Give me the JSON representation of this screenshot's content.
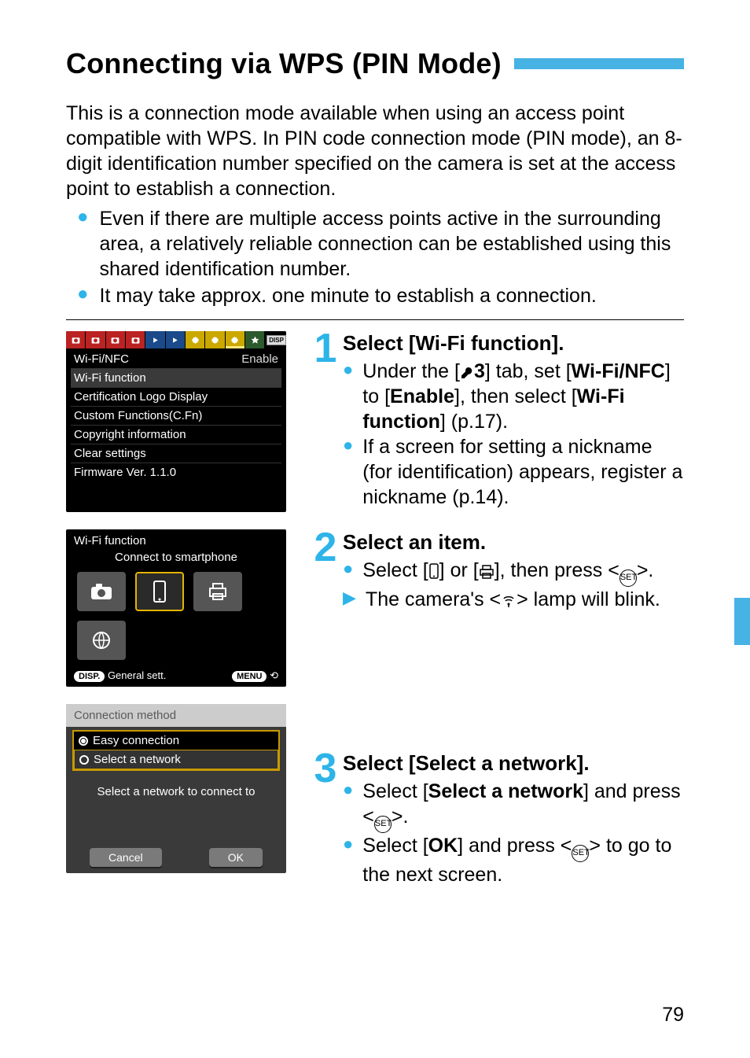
{
  "title": "Connecting via WPS (PIN Mode)",
  "intro": "This is a connection mode available when using an access point compatible with WPS. In PIN code connection mode (PIN mode), an 8-digit identification number specified on the camera is set at the access point to establish a connection.",
  "top_bullets": [
    "Even if there are multiple access points active in the surrounding area, a relatively reliable connection can be established using this shared identification number.",
    "It may take approx. one minute to establish a connection."
  ],
  "screen1": {
    "rows": [
      {
        "label": "Wi-Fi/NFC",
        "value": "Enable"
      },
      {
        "label": "Wi-Fi function",
        "value": ""
      },
      {
        "label": "Certification Logo Display",
        "value": ""
      },
      {
        "label": "Custom Functions(C.Fn)",
        "value": ""
      },
      {
        "label": "Copyright information",
        "value": ""
      },
      {
        "label": "Clear settings",
        "value": ""
      },
      {
        "label": "Firmware Ver. 1.1.0",
        "value": ""
      }
    ]
  },
  "screen2": {
    "title": "Wi-Fi function",
    "subtitle": "Connect to smartphone",
    "footer_left_badge": "DISP.",
    "footer_left": "General sett.",
    "footer_right_badge": "MENU"
  },
  "screen3": {
    "title": "Connection method",
    "opt1": "Easy connection",
    "opt2": "Select a network",
    "msg": "Select a network to connect to",
    "cancel": "Cancel",
    "ok": "OK"
  },
  "steps": {
    "s1": {
      "num": "1",
      "title": "Select [Wi-Fi function].",
      "b1_pre": "Under the [",
      "b1_tab": "3",
      "b1_mid": "] tab, set [",
      "b1_bold1": "Wi-Fi/NFC",
      "b1_mid2": "] to [",
      "b1_bold2": "Enable",
      "b1_mid3": "], then select [",
      "b1_bold3": "Wi-Fi function",
      "b1_end": "] (p.17).",
      "b2": "If a screen for setting a nickname (for identification) appears, register a nickname (p.14)."
    },
    "s2": {
      "num": "2",
      "title": "Select an item.",
      "b1_pre": "Select [",
      "b1_mid": "] or [",
      "b1_mid2": "], then press <",
      "b1_end": ">.",
      "b2_pre": "The camera's <",
      "b2_end": "> lamp will blink."
    },
    "s3": {
      "num": "3",
      "title": "Select [Select a network].",
      "b1_pre": "Select [",
      "b1_bold": "Select a network",
      "b1_mid": "] and press <",
      "b1_end": ">.",
      "b2_pre": "Select [",
      "b2_bold": "OK",
      "b2_mid": "] and press <",
      "b2_end": "> to go to the next screen."
    }
  },
  "page_number": "79"
}
